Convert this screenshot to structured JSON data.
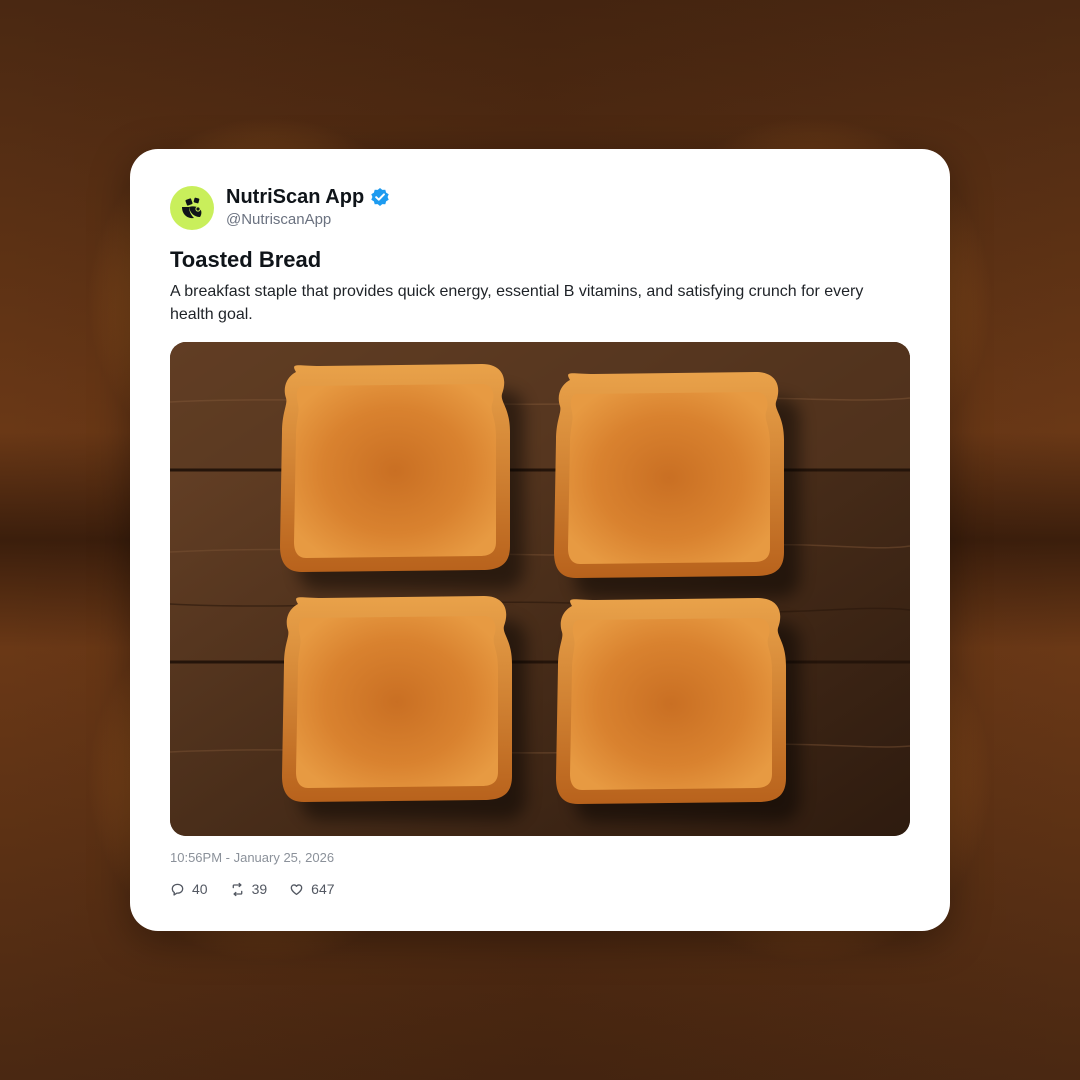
{
  "post": {
    "author": {
      "display_name": "NutriScan App",
      "handle": "@NutriscanApp",
      "verified": true,
      "avatar_color": "#c9ef5b"
    },
    "title": "Toasted Bread",
    "text": "A breakfast staple that provides quick energy, essential B vitamins, and satisfying crunch for every health goal.",
    "image": {
      "subject": "four slices of toasted bread on a wooden board"
    },
    "timestamp": "10:56PM - January 25, 2026",
    "stats": {
      "replies": "40",
      "reposts": "39",
      "likes": "647"
    }
  },
  "colors": {
    "verified_badge": "#1d9bf0",
    "toast": "#d9822f",
    "wood": "#4a2e1a"
  },
  "icons": {
    "avatar_logo": "nutriscan-logo-icon",
    "verified": "verified-badge-icon",
    "reply": "reply-icon",
    "repost": "repost-icon",
    "like": "heart-icon"
  }
}
